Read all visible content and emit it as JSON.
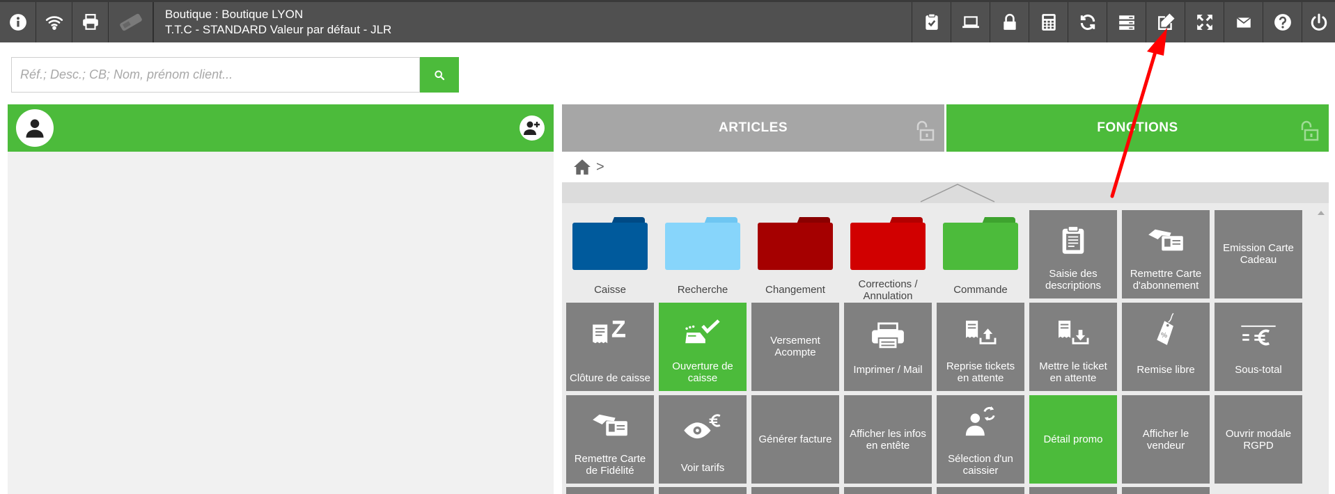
{
  "topbar": {
    "shop_line": "Boutique : Boutique LYON",
    "tariff_line": "T.T.C - STANDARD Valeur par défaut - JLR",
    "left_icons": [
      "info-icon",
      "wifi-icon",
      "printer-icon",
      "payment-terminal-icon"
    ],
    "right_icons": [
      "clipboard-check-icon",
      "laptop-icon",
      "lock-icon",
      "calculator-icon",
      "refresh-icon",
      "server-icon",
      "edit-icon",
      "fullscreen-icon",
      "mail-icon",
      "help-icon",
      "power-icon"
    ]
  },
  "search": {
    "placeholder": "Réf.; Desc.; CB; Nom, prénom client..."
  },
  "tabs": {
    "articles": "ARTICLES",
    "fonctions": "FONCTIONS"
  },
  "breadcrumb": {
    "separator": ">"
  },
  "folders": [
    {
      "label": "Caisse",
      "color": "#005a9c",
      "tab_color": "#004a85"
    },
    {
      "label": "Recherche",
      "color": "#87d5fb",
      "tab_color": "#6ec6f2"
    },
    {
      "label": "Changement",
      "color": "#a50000",
      "tab_color": "#8a0000"
    },
    {
      "label": "Corrections / Annulation",
      "color": "#d10000",
      "tab_color": "#b20000"
    },
    {
      "label": "Commande",
      "color": "#4cbb3b",
      "tab_color": "#3ea32f"
    }
  ],
  "tiles_row1": [
    {
      "label": "Saisie des descriptions",
      "icon": "clipboard-icon"
    },
    {
      "label": "Remettre Carte d'abonnement",
      "icon": "hand-card-icon"
    },
    {
      "label": "Emission Carte Cadeau",
      "icon": ""
    }
  ],
  "tiles_row2": [
    {
      "label": "Clôture de caisse",
      "icon": "receipt-z-icon",
      "green": false
    },
    {
      "label": "Ouverture de caisse",
      "icon": "register-check-icon",
      "green": true
    },
    {
      "label": "Versement Acompte",
      "icon": "",
      "green": false
    },
    {
      "label": "Imprimer / Mail",
      "icon": "printer-icon",
      "green": false
    },
    {
      "label": "Reprise tickets en attente",
      "icon": "ticket-upload-icon",
      "green": false
    },
    {
      "label": "Mettre le ticket en attente",
      "icon": "ticket-download-icon",
      "green": false
    },
    {
      "label": "Remise libre",
      "icon": "price-tag-icon",
      "green": false
    },
    {
      "label": "Sous-total",
      "icon": "subtotal-euro-icon",
      "green": false
    }
  ],
  "tiles_row3": [
    {
      "label": "Remettre Carte de Fidélité",
      "icon": "hand-card-icon",
      "green": false
    },
    {
      "label": "Voir tarifs",
      "icon": "eye-euro-icon",
      "green": false
    },
    {
      "label": "Générer facture",
      "icon": "",
      "green": false
    },
    {
      "label": "Afficher les infos en entête",
      "icon": "",
      "green": false
    },
    {
      "label": "Sélection d'un caissier",
      "icon": "user-switch-icon",
      "green": false
    },
    {
      "label": "Détail promo",
      "icon": "",
      "green": true
    },
    {
      "label": "Afficher le vendeur",
      "icon": "",
      "green": false
    },
    {
      "label": "Ouvrir modale RGPD",
      "icon": "",
      "green": false
    }
  ],
  "colors": {
    "topbar": "#505050",
    "accent_green": "#4cbb3b",
    "tile_gray": "#808080",
    "annotation_arrow": "#ff0000"
  }
}
